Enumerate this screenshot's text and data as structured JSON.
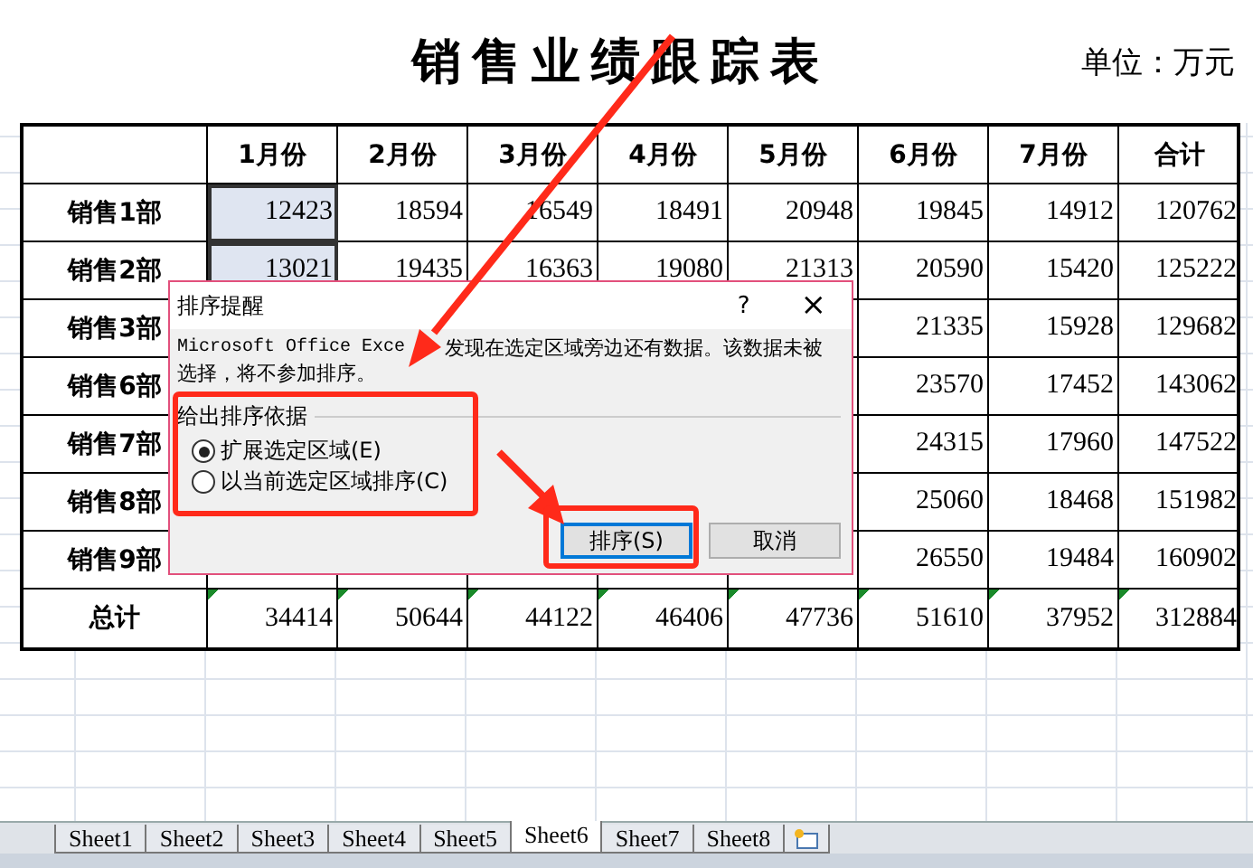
{
  "sheet": {
    "title": "销售业绩跟踪表",
    "unit": "单位：万元",
    "columns": [
      null,
      "1月份",
      "2月份",
      "3月份",
      "4月份",
      "5月份",
      "6月份",
      "7月份",
      "合计"
    ],
    "rows": [
      {
        "cells": [
          "销售1部",
          "12423",
          "18594",
          "16549",
          "18491",
          "20948",
          "19845",
          "14912",
          "120762"
        ],
        "selected": true
      },
      {
        "cells": [
          "销售2部",
          "13021",
          "19435",
          "16363",
          "19080",
          "21313",
          "20590",
          "15420",
          "125222"
        ],
        "selected": true
      },
      {
        "cells": [
          "销售3部",
          null,
          null,
          null,
          null,
          null,
          "21335",
          "15928",
          "129682"
        ],
        "selected": false
      },
      {
        "cells": [
          "销售6部",
          null,
          null,
          null,
          null,
          null,
          "23570",
          "17452",
          "143062"
        ],
        "selected": false
      },
      {
        "cells": [
          "销售7部",
          null,
          null,
          null,
          null,
          null,
          "24315",
          "17960",
          "147522"
        ],
        "selected": false
      },
      {
        "cells": [
          "销售8部",
          null,
          null,
          null,
          null,
          null,
          "25060",
          "18468",
          "151982"
        ],
        "selected": false
      },
      {
        "cells": [
          "销售9部",
          null,
          null,
          null,
          null,
          null,
          "26550",
          "19484",
          "160902"
        ],
        "selected": false
      },
      {
        "cells": [
          "总计",
          "34414",
          "50644",
          "44122",
          "46406",
          "47736",
          "51610",
          "37952",
          "312884"
        ],
        "selected": false
      }
    ]
  },
  "dialog": {
    "title": "排序提醒",
    "help": "?",
    "close": "×",
    "message_lines": [
      "Microsoft Office Exce",
      "发现在选定区域旁边还有数据。该数据未被",
      "选择，将不参加排序。"
    ],
    "group_label": "给出排序依据",
    "options": [
      {
        "label": "扩展选定区域(E)",
        "selected": true
      },
      {
        "label": "以当前选定区域排序(C)",
        "selected": false
      }
    ],
    "buttons": [
      {
        "label": "排序(S)",
        "kind": "default"
      },
      {
        "label": "取消",
        "kind": "normal"
      }
    ]
  },
  "sheet_tabs": [
    {
      "label": "Sheet1",
      "selected": false
    },
    {
      "label": "Sheet2",
      "selected": false
    },
    {
      "label": "Sheet3",
      "selected": false
    },
    {
      "label": "Sheet4",
      "selected": false
    },
    {
      "label": "Sheet5",
      "selected": false
    },
    {
      "label": "Sheet6",
      "selected": true
    },
    {
      "label": "Sheet7",
      "selected": false
    },
    {
      "label": "Sheet8",
      "selected": false
    }
  ]
}
